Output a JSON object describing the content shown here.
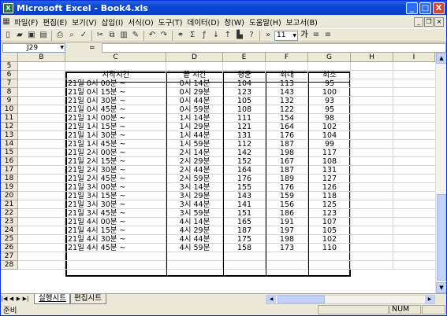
{
  "window": {
    "title": "Microsoft Excel - Book4.xls",
    "app_icon": "excel-icon",
    "minimize": "_",
    "maximize": "□",
    "close": "X"
  },
  "menu": [
    "파일(F)",
    "편집(E)",
    "보기(V)",
    "삽입(I)",
    "서식(O)",
    "도구(T)",
    "데이터(D)",
    "창(W)",
    "도움말(H)",
    "보고서(B)"
  ],
  "toolbar": {
    "font_size": "11",
    "bold": "가",
    "align_left": "≡",
    "align_center": "≡"
  },
  "formula": {
    "namebox": "J29",
    "fx": "=",
    "value": ""
  },
  "columns": [
    "B",
    "C",
    "D",
    "E",
    "F",
    "G",
    "H",
    "I"
  ],
  "rows": [
    "5",
    "6",
    "7",
    "8",
    "9",
    "10",
    "11",
    "12",
    "13",
    "14",
    "15",
    "16",
    "17",
    "18",
    "19",
    "20",
    "21",
    "22",
    "23",
    "24",
    "25",
    "26",
    "27",
    "28"
  ],
  "table": {
    "headers": [
      "시작시간",
      "끝 시간",
      "평균",
      "최대",
      "최소"
    ],
    "rows": [
      [
        "21일 0시 00분 ~",
        "0시 14분",
        "104",
        "113",
        "95"
      ],
      [
        "21일 0시 15분 ~",
        "0시 29분",
        "123",
        "143",
        "100"
      ],
      [
        "21일 0시 30분 ~",
        "0시 44분",
        "105",
        "132",
        "93"
      ],
      [
        "21일 0시 45분 ~",
        "0시 59분",
        "108",
        "122",
        "95"
      ],
      [
        "21일 1시 00분 ~",
        "1시 14분",
        "111",
        "154",
        "98"
      ],
      [
        "21일 1시 15분 ~",
        "1시 29분",
        "121",
        "164",
        "102"
      ],
      [
        "21일 1시 30분 ~",
        "1시 44분",
        "131",
        "176",
        "104"
      ],
      [
        "21일 1시 45분 ~",
        "1시 59분",
        "112",
        "187",
        "99"
      ],
      [
        "21일 2시 00분 ~",
        "2시 14분",
        "142",
        "198",
        "117"
      ],
      [
        "21일 2시 15분 ~",
        "2시 29분",
        "152",
        "167",
        "108"
      ],
      [
        "21일 2시 30분 ~",
        "2시 44분",
        "164",
        "187",
        "131"
      ],
      [
        "21일 2시 45분 ~",
        "2시 59분",
        "176",
        "189",
        "127"
      ],
      [
        "21일 3시 00분 ~",
        "3시 14분",
        "155",
        "176",
        "126"
      ],
      [
        "21일 3시 15분 ~",
        "3시 29분",
        "143",
        "159",
        "118"
      ],
      [
        "21일 3시 30분 ~",
        "3시 44분",
        "141",
        "156",
        "125"
      ],
      [
        "21일 3시 45분 ~",
        "3시 59분",
        "151",
        "186",
        "123"
      ],
      [
        "21일 4시 00분 ~",
        "4시 14분",
        "165",
        "191",
        "107"
      ],
      [
        "21일 4시 15분 ~",
        "4시 29분",
        "187",
        "197",
        "105"
      ],
      [
        "21일 4시 30분 ~",
        "4시 44분",
        "175",
        "198",
        "102"
      ],
      [
        "21일 4시 45분 ~",
        "4시 59분",
        "158",
        "173",
        "110"
      ]
    ]
  },
  "sheets": [
    "실행시트",
    "편집시트"
  ],
  "status": {
    "mode": "준비",
    "num": "NUM"
  }
}
